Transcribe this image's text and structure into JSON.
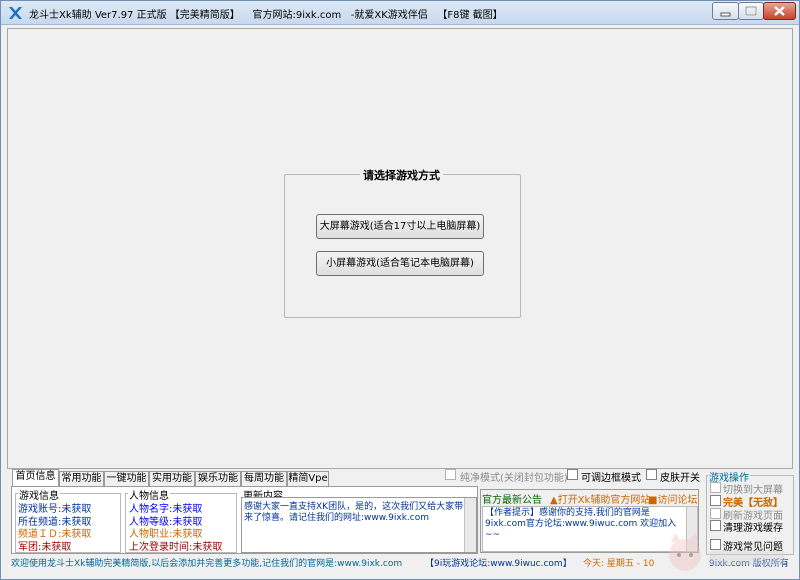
{
  "window": {
    "title": "龙斗士Xk辅助 Ver7.97 正式版 【完美精简版】    官方网站:9ixk.com   -就爱XK游戏伴侣   【F8键 截图】"
  },
  "main": {
    "select_group_title": "请选择游戏方式",
    "big_screen_button": "大屏幕游戏(适合17寸以上电脑屏幕)",
    "small_screen_button": "小屏幕游戏(适合笔记本电脑屏幕)"
  },
  "tabs": [
    {
      "label": "首页信息",
      "active": true
    },
    {
      "label": "常用功能",
      "active": false
    },
    {
      "label": "一键功能",
      "active": false
    },
    {
      "label": "实用功能",
      "active": false
    },
    {
      "label": "娱乐功能",
      "active": false
    },
    {
      "label": "每周功能",
      "active": false
    },
    {
      "label": "精简Vpe",
      "active": false
    }
  ],
  "game_info": {
    "title": "游戏信息",
    "account": "游戏账号:未获取",
    "channel": "所在频道:未获取",
    "channel_id": "频道ＩＤ:未获取",
    "legion": "军团:未获取"
  },
  "character_info": {
    "title": "人物信息",
    "name": "人物名字:未获取",
    "level": "人物等级:未获取",
    "job": "人物职业:未获取",
    "last_login": "上次登录时间:未获取"
  },
  "news": {
    "title": "更新内容",
    "text": "感谢大家一直支持XK团队，是的，这次我们又给大家带来了惊喜。请记住我们的网址:www.9ixk.com"
  },
  "options": {
    "pure_mode": "纯净模式(关闭封包功能)",
    "border_mode": "可调边框模式",
    "skin_switch": "皮肤开关"
  },
  "official": {
    "title": "官方最新公告",
    "open_site": "▲打开Xk辅助官方网站",
    "visit_forum": "■访问论坛",
    "text": "【作者提示】感谢你的支持,我们的官网是 9ixk.com官方论坛:www.9iwuc.com 欢迎加入~~"
  },
  "game_ops": {
    "title": "游戏操作",
    "items": [
      {
        "label": "切换到大屏幕",
        "enabled": false
      },
      {
        "label": "完美【无敌】",
        "enabled": true,
        "highlight": true
      },
      {
        "label": "刷新游戏页面",
        "enabled": false
      },
      {
        "label": "清理游戏缓存",
        "enabled": true
      },
      {
        "label": "游戏常见问题",
        "enabled": true
      }
    ]
  },
  "statusbar": {
    "left": "欢迎使用龙斗士Xk辅助完美精简版,以后会添加并完善更多功能,记住我们的官网是:www.9ixk.com",
    "forum": "【9i玩游戏论坛:www.9iwuc.com】",
    "today": "今天: 星期五 - 10",
    "copyright": "9ixk.com 版权所有"
  },
  "colors": {
    "titlebar": "#c8d9ee",
    "link_orange": "#cc6600",
    "info_blue": "#0000ff",
    "close_red": "#c7402b"
  }
}
